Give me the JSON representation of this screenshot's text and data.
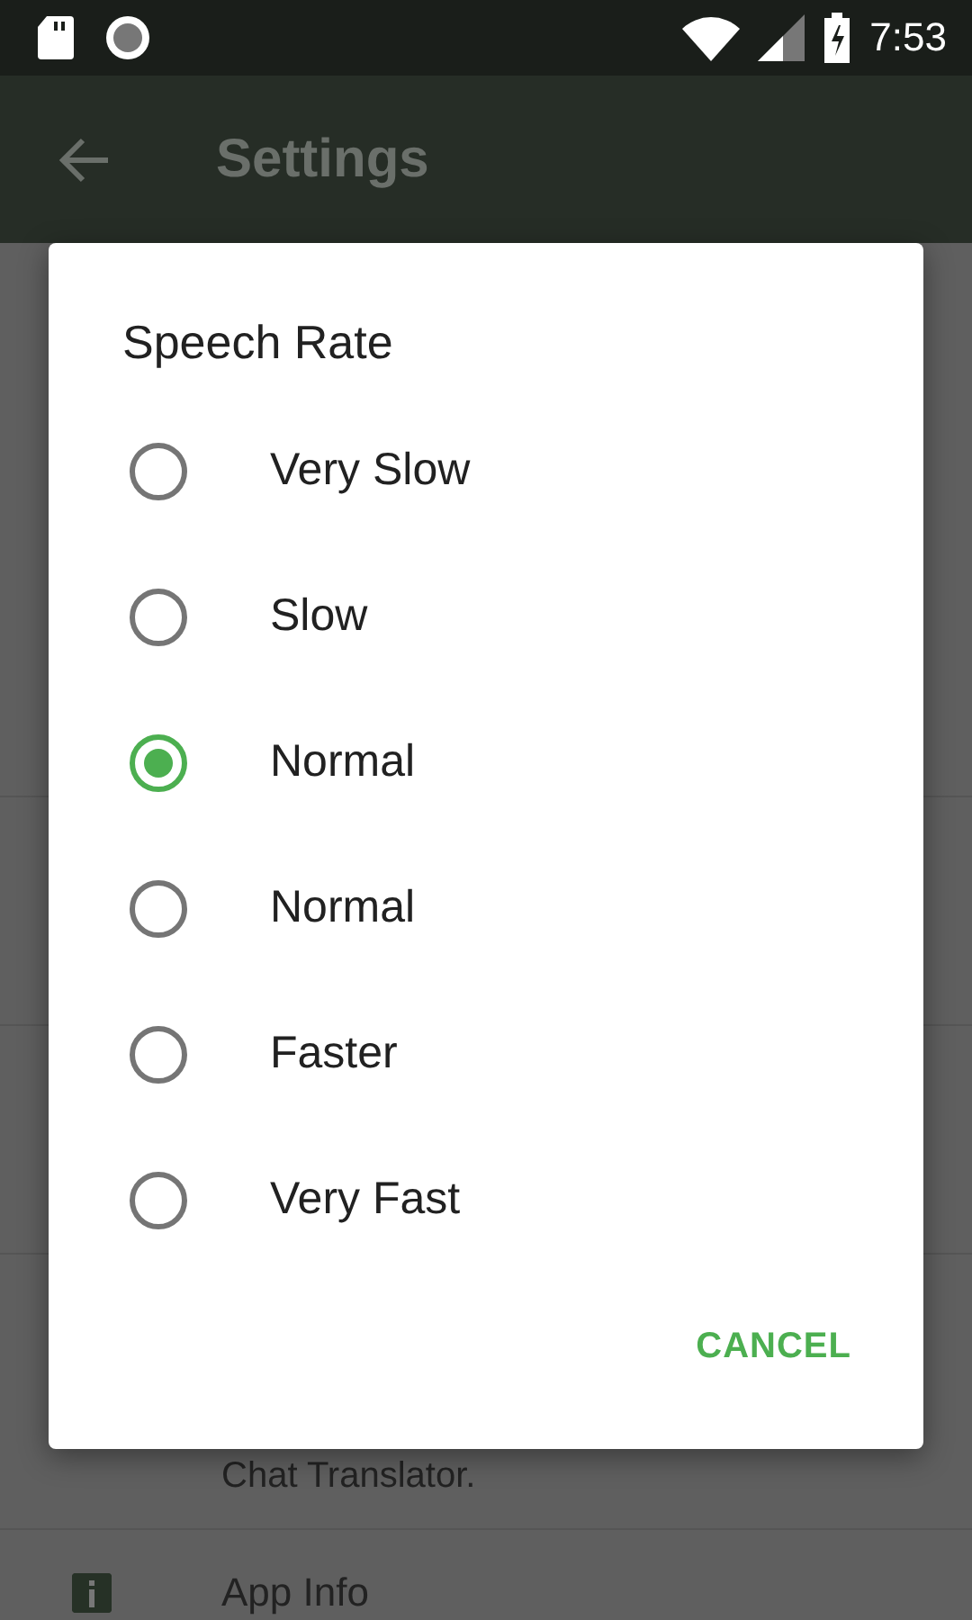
{
  "status_bar": {
    "time": "7:53"
  },
  "app_bar": {
    "title": "Settings"
  },
  "settings_list": {
    "summary": "Chat Translator.",
    "item_label": "App Info"
  },
  "dialog": {
    "title": "Speech Rate",
    "options": [
      {
        "label": "Very Slow",
        "selected": false
      },
      {
        "label": "Slow",
        "selected": false
      },
      {
        "label": "Normal",
        "selected": true
      },
      {
        "label": "Normal",
        "selected": false
      },
      {
        "label": "Faster",
        "selected": false
      },
      {
        "label": "Very Fast",
        "selected": false
      }
    ],
    "buttons": [
      "CANCEL"
    ]
  }
}
